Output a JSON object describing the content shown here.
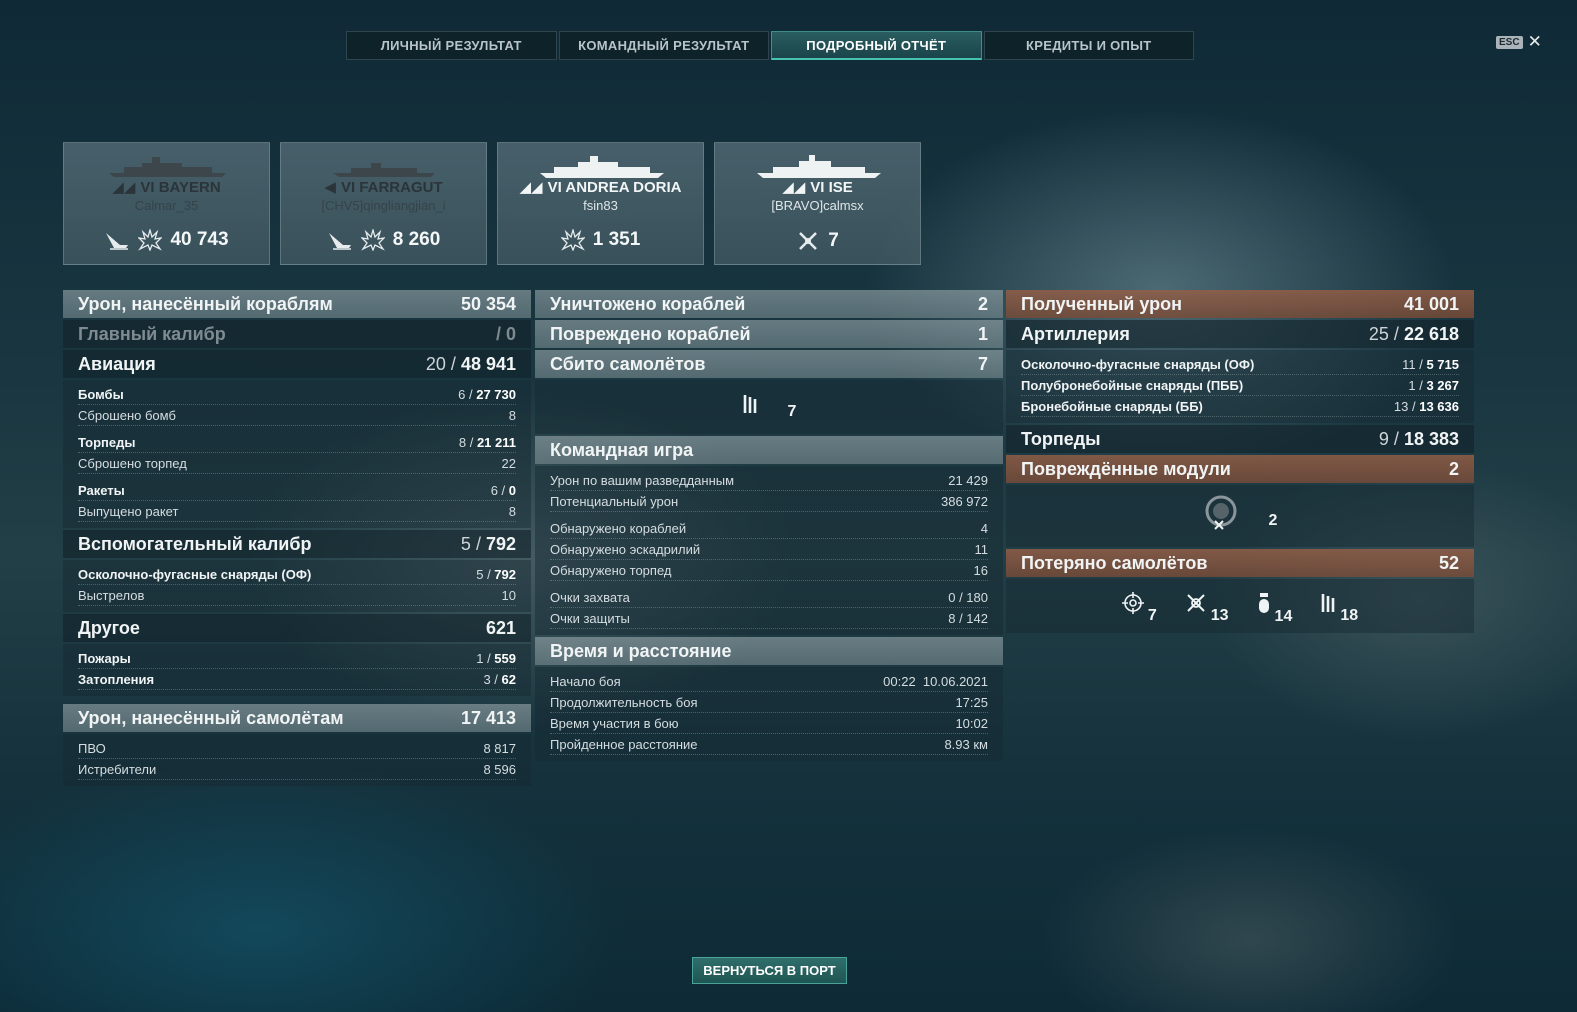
{
  "tabs": [
    {
      "label": "ЛИЧНЫЙ РЕЗУЛЬТАТ",
      "active": false
    },
    {
      "label": "КОМАНДНЫЙ РЕЗУЛЬТАТ",
      "active": false
    },
    {
      "label": "ПОДРОБНЫЙ ОТЧЁТ",
      "active": true
    },
    {
      "label": "КРЕДИТЫ И ОПЫТ",
      "active": false
    }
  ],
  "esc": {
    "key": "ESC"
  },
  "cards": [
    {
      "ship": "VI BAYERN",
      "player": "Calmar_35",
      "value": "40 743",
      "icons": [
        "ship-sunk-icon",
        "explosion-icon"
      ]
    },
    {
      "ship": "VI FARRAGUT",
      "player": "[CHV5]qingliangjian_i",
      "value": "8 260",
      "icons": [
        "ship-sunk-icon",
        "explosion-icon"
      ]
    },
    {
      "ship": "VI ANDREA DORIA",
      "player": "fsin83",
      "value": "1 351",
      "icons": [
        "explosion-icon"
      ]
    },
    {
      "ship": "VI ISE",
      "player": "[BRAVO]calmsx",
      "value": "7",
      "icons": [
        "plane-shot-down-icon"
      ]
    }
  ],
  "col1": {
    "ship_damage": {
      "label": "Урон, нанесённый кораблям",
      "value": "50 354"
    },
    "main_caliber": {
      "label": "Главный калибр",
      "value": "/ 0"
    },
    "aviation": {
      "label": "Авиация",
      "hits": "20",
      "value": "48 941"
    },
    "bombs": {
      "label": "Бомбы",
      "hits": "6",
      "value": "27 730"
    },
    "bombs_dropped": {
      "label": "Сброшено бомб",
      "value": "8"
    },
    "torpedoes": {
      "label": "Торпеды",
      "hits": "8",
      "value": "21 211"
    },
    "torpedoes_dropped": {
      "label": "Сброшено торпед",
      "value": "22"
    },
    "rockets": {
      "label": "Ракеты",
      "hits": "6",
      "value": "0"
    },
    "rockets_fired": {
      "label": "Выпущено ракет",
      "value": "8"
    },
    "secondary": {
      "label": "Вспомогательный калибр",
      "hits": "5",
      "value": "792"
    },
    "secondary_he": {
      "label": "Осколочно-фугасные снаряды (ОФ)",
      "hits": "5",
      "value": "792"
    },
    "shots": {
      "label": "Выстрелов",
      "value": "10"
    },
    "other": {
      "label": "Другое",
      "value": "621"
    },
    "fires": {
      "label": "Пожары",
      "hits": "1",
      "value": "559"
    },
    "floods": {
      "label": "Затопления",
      "hits": "3",
      "value": "62"
    },
    "plane_damage": {
      "label": "Урон, нанесённый самолётам",
      "value": "17 413"
    },
    "aa": {
      "label": "ПВО",
      "value": "8 817"
    },
    "fighters": {
      "label": "Истребители",
      "value": "8 596"
    }
  },
  "col2": {
    "destroyed": {
      "label": "Уничтожено кораблей",
      "value": "2"
    },
    "damaged": {
      "label": "Повреждено кораблей",
      "value": "1"
    },
    "planes_down": {
      "label": "Сбито самолётов",
      "value": "7"
    },
    "planes_icon_value": "7",
    "team": {
      "label": "Командная игра"
    },
    "spotting_damage": {
      "label": "Урон по вашим разведданным",
      "value": "21 429"
    },
    "potential_damage": {
      "label": "Потенциальный урон",
      "value": "386 972"
    },
    "ships_spotted": {
      "label": "Обнаружено кораблей",
      "value": "4"
    },
    "squadrons_spotted": {
      "label": "Обнаружено эскадрилий",
      "value": "11"
    },
    "torps_spotted": {
      "label": "Обнаружено торпед",
      "value": "16"
    },
    "capture": {
      "label": "Очки захвата",
      "value": "0 / 180"
    },
    "defense": {
      "label": "Очки защиты",
      "value": "8 / 142"
    },
    "time": {
      "label": "Время и расстояние"
    },
    "start": {
      "label": "Начало боя",
      "value": "00:22  10.06.2021"
    },
    "duration": {
      "label": "Продолжительность боя",
      "value": "17:25"
    },
    "participation": {
      "label": "Время участия в бою",
      "value": "10:02"
    },
    "distance": {
      "label": "Пройденное расстояние",
      "value": "8.93 км"
    }
  },
  "col3": {
    "received": {
      "label": "Полученный урон",
      "value": "41 001"
    },
    "artillery": {
      "label": "Артиллерия",
      "hits": "25",
      "value": "22 618"
    },
    "he": {
      "label": "Осколочно-фугасные снаряды (ОФ)",
      "hits": "11",
      "value": "5 715"
    },
    "sap": {
      "label": "Полубронебойные снаряды (ПББ)",
      "hits": "1",
      "value": "3 267"
    },
    "ap": {
      "label": "Бронебойные снаряды (ББ)",
      "hits": "13",
      "value": "13 636"
    },
    "torpedoes": {
      "label": "Торпеды",
      "hits": "9",
      "value": "18 383"
    },
    "modules": {
      "label": "Повреждённые модули",
      "value": "2"
    },
    "modules_icon_value": "2",
    "planes_lost": {
      "label": "Потеряно самолётов",
      "value": "52"
    },
    "lost_icons": [
      {
        "icon": "crosshair-icon",
        "value": "7"
      },
      {
        "icon": "fighter-icon",
        "value": "13"
      },
      {
        "icon": "bomb-icon",
        "value": "14"
      },
      {
        "icon": "torpedo-icon",
        "value": "18"
      }
    ]
  },
  "footer": {
    "back_label": "ВЕРНУТЬСЯ В ПОРТ"
  }
}
